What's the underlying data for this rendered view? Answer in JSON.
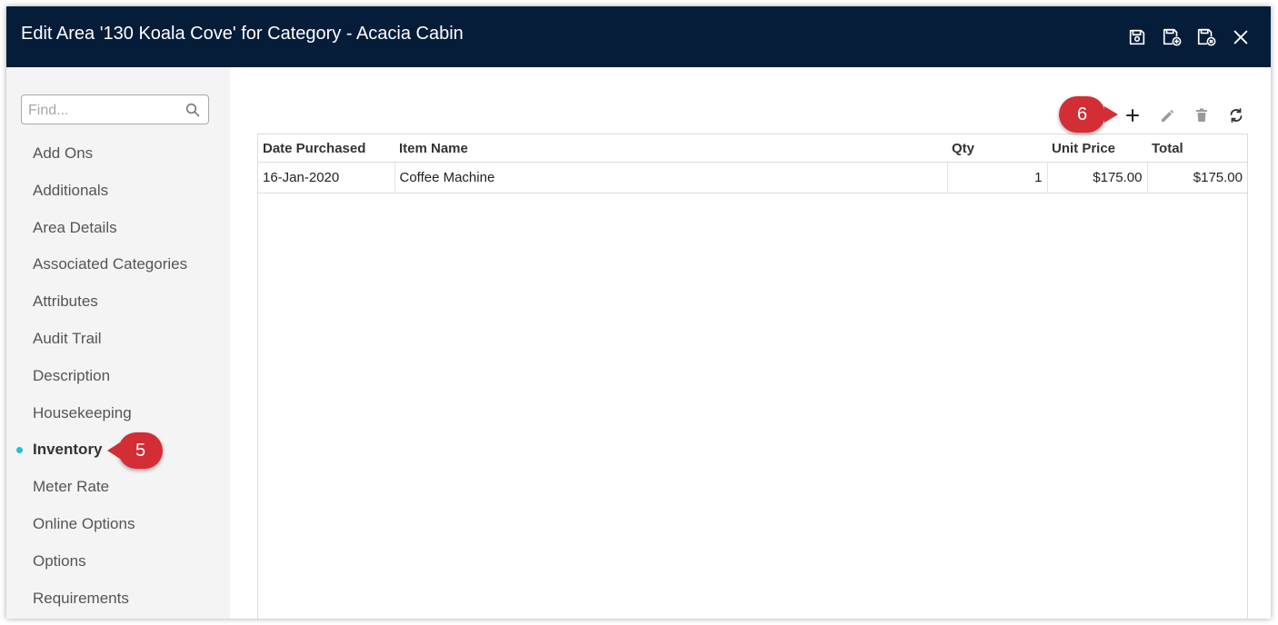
{
  "window": {
    "title": "Edit Area '130 Koala Cove' for Category - Acacia Cabin",
    "header_color": "#061d3a",
    "title_icons": [
      "save-icon",
      "save-and-new-icon",
      "save-and-close-icon",
      "close-icon"
    ]
  },
  "sidebar": {
    "search_placeholder": "Find...",
    "items": [
      {
        "label": "Add Ons"
      },
      {
        "label": "Additionals"
      },
      {
        "label": "Area Details"
      },
      {
        "label": "Associated Categories"
      },
      {
        "label": "Attributes"
      },
      {
        "label": "Audit Trail"
      },
      {
        "label": "Description"
      },
      {
        "label": "Housekeeping"
      },
      {
        "label": "Inventory",
        "active": true
      },
      {
        "label": "Meter Rate"
      },
      {
        "label": "Online Options"
      },
      {
        "label": "Options"
      },
      {
        "label": "Requirements"
      }
    ],
    "active_indicator_color": "#1ec2d3"
  },
  "callouts": {
    "step5": "5",
    "step6": "6",
    "color": "#d32d35"
  },
  "toolbar": {
    "icons": [
      "plus-icon",
      "pencil-icon",
      "trash-icon",
      "refresh-icon"
    ]
  },
  "grid": {
    "columns": [
      "Date Purchased",
      "Item Name",
      "Qty",
      "Unit Price",
      "Total"
    ],
    "rows": [
      {
        "date": "16-Jan-2020",
        "item": "Coffee Machine",
        "qty": "1",
        "unit_price": "$175.00",
        "total": "$175.00"
      }
    ]
  }
}
